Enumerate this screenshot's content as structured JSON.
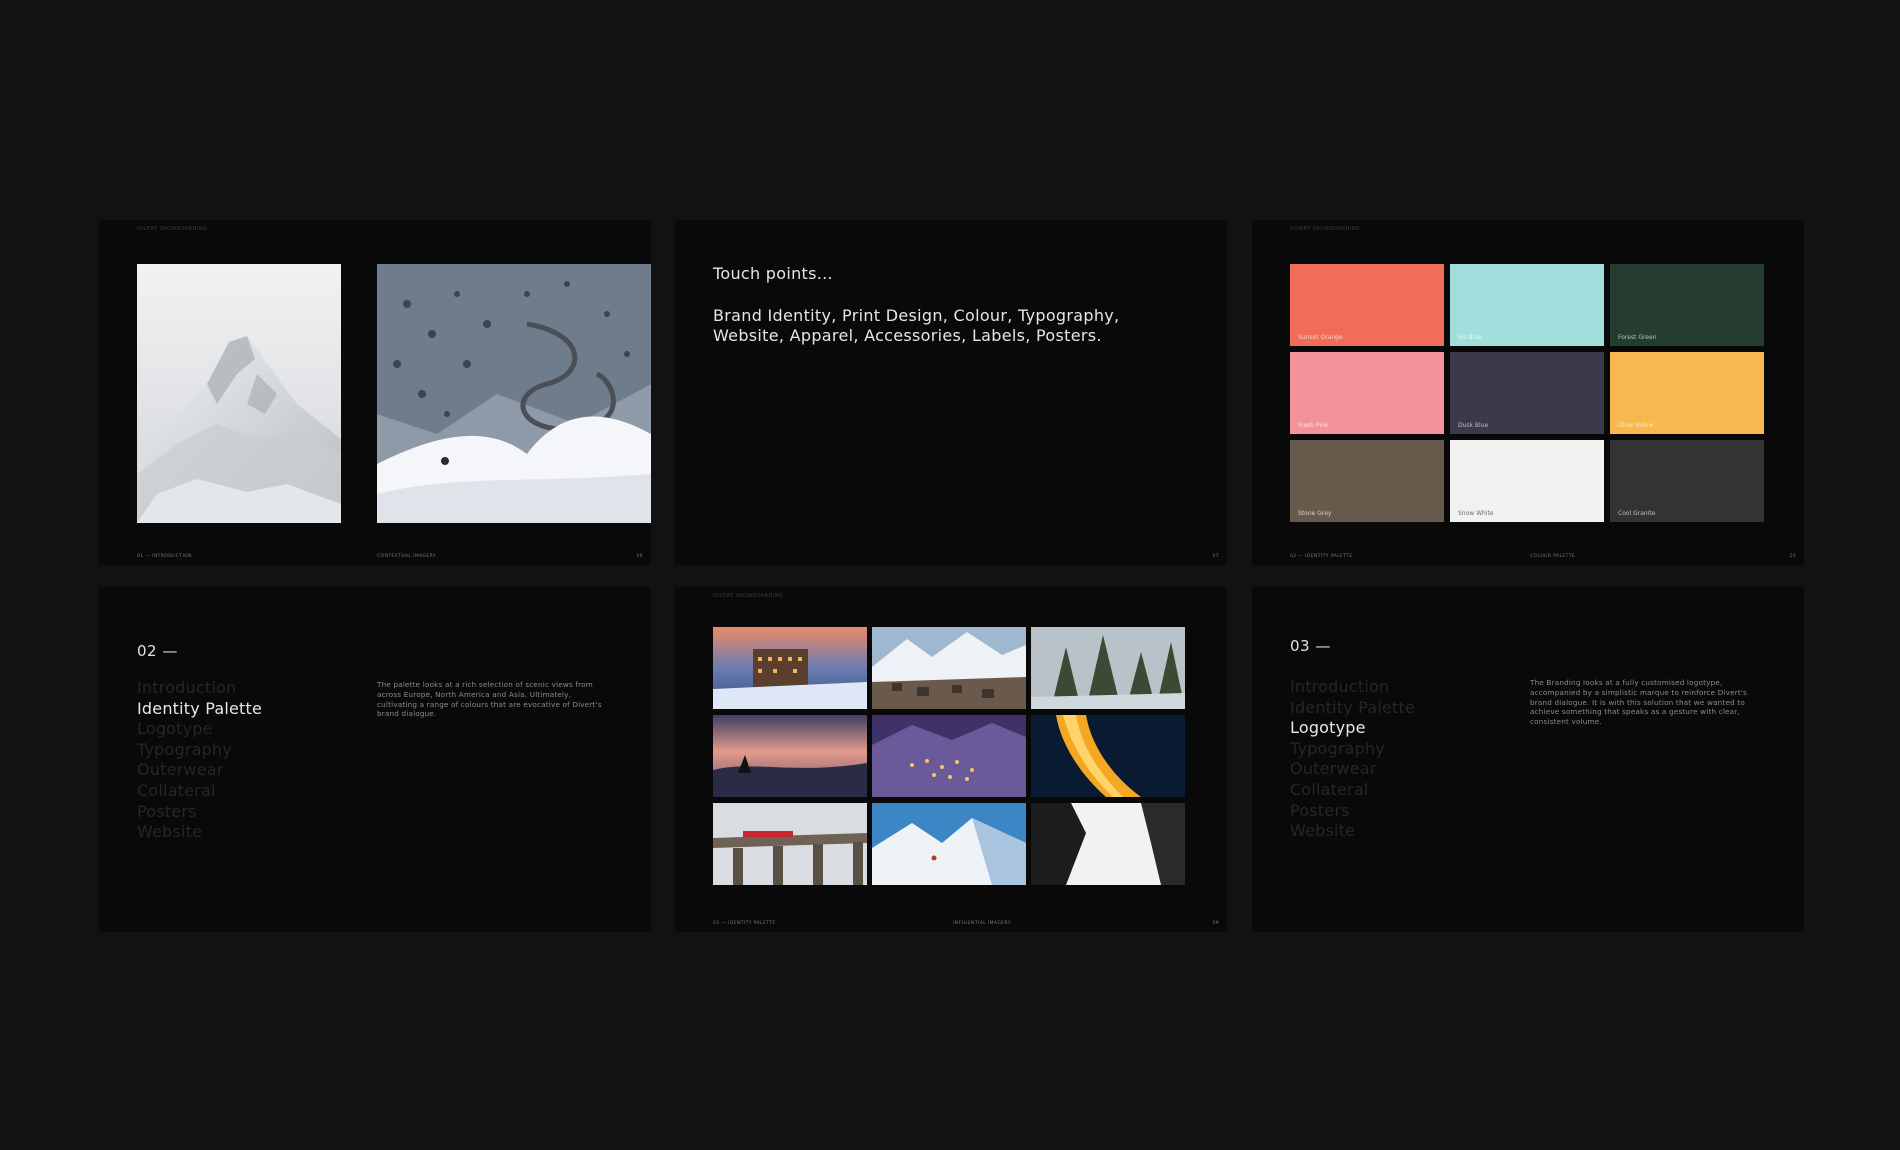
{
  "slides": {
    "s1": {
      "header": "DIVERT SNOWBOARDING",
      "footer_left": "01 — INTRODUCTION",
      "footer_center": "CONTEXTUAL IMAGERY",
      "page": "06"
    },
    "s2": {
      "title": "Touch points...",
      "body": "Brand Identity, Print Design, Colour, Typography, Website, Apparel, Accessories, Labels, Posters.",
      "page": "07"
    },
    "s3": {
      "header": "DIVERT SNOWBOARDING",
      "footer_left": "02 — IDENTITY PALETTE",
      "footer_center": "COLOUR PALETTE",
      "page": "10",
      "swatches": [
        {
          "name": "Sunset Orange",
          "color": "#f06d59",
          "label_color": "#fbd0c8"
        },
        {
          "name": "Ice Blue",
          "color": "#a2dedc",
          "label_color": "#e8fbfa"
        },
        {
          "name": "Forest Green",
          "color": "#243d30",
          "label_color": "#b4c6bc"
        },
        {
          "name": "Fresh Pink",
          "color": "#f39399",
          "label_color": "#fde2e4"
        },
        {
          "name": "Dusk Blue",
          "color": "#3b3a4a",
          "label_color": "#bdbcc9"
        },
        {
          "name": "Glow Yellow",
          "color": "#f6b84f",
          "label_color": "#fde9c4"
        },
        {
          "name": "Stone Grey",
          "color": "#665a4d",
          "label_color": "#ddd3c8"
        },
        {
          "name": "Snow White",
          "color": "#f1f1f1",
          "label_color": "#6c6c6c"
        },
        {
          "name": "Cool Granite",
          "color": "#333333",
          "label_color": "#c2c2c2"
        }
      ]
    },
    "s4": {
      "number": "02 —",
      "toc": [
        "Introduction",
        "Identity Palette",
        "Logotype",
        "Typography",
        "Outerwear",
        "Collateral",
        "Posters",
        "Website"
      ],
      "active_index": 1,
      "description": "The palette looks at a rich selection of scenic views from across Europe, North America and Asia. Ultimately, cultivating a range of colours that are evocative of Divert's brand dialogue."
    },
    "s5": {
      "header": "DIVERT SNOWBOARDING",
      "footer_left": "02 — IDENTITY PALETTE",
      "footer_center": "INFLUENTIAL IMAGERY",
      "page": "09"
    },
    "s6": {
      "number": "03 —",
      "toc": [
        "Introduction",
        "Identity Palette",
        "Logotype",
        "Typography",
        "Outerwear",
        "Collateral",
        "Posters",
        "Website"
      ],
      "active_index": 2,
      "description": "The Branding looks at a fully customised logotype, accompanied by a simplistic marque to reinforce Divert's brand dialogue. It is with this solution that we wanted to achieve something that speaks as a gesture with clear, consistent volume."
    }
  }
}
